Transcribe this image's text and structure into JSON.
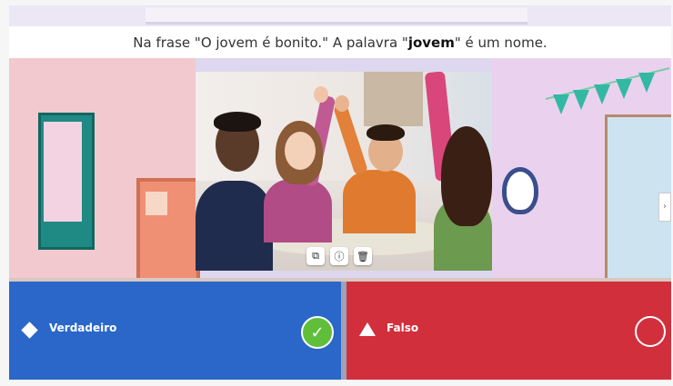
{
  "question": {
    "prefix": "Na frase \"O jovem é bonito.\" A palavra \"",
    "keyword": "jovem",
    "suffix": "\" é um nome."
  },
  "photo": {
    "toolbar": [
      {
        "icon": "crop-icon",
        "glyph": "⧉"
      },
      {
        "icon": "info-icon",
        "glyph": "ⓘ"
      },
      {
        "icon": "trash-icon",
        "glyph": "🗑"
      }
    ]
  },
  "answers": [
    {
      "shape": "diamond",
      "label": "Verdadeiro",
      "color": "#2a67c9",
      "selected": true
    },
    {
      "shape": "triangle",
      "label": "Falso",
      "color": "#d22f3d",
      "selected": false
    }
  ],
  "colors": {
    "true_answer": "#2a67c9",
    "false_answer": "#d22f3d",
    "check": "#5fbf3a"
  }
}
